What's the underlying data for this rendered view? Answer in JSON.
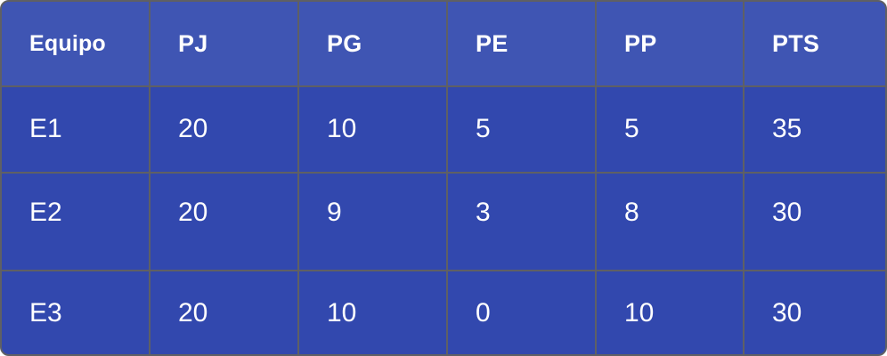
{
  "table": {
    "headers": [
      "Equipo",
      "PJ",
      "PG",
      "PE",
      "PP",
      "PTS"
    ],
    "rows": [
      [
        "E1",
        "20",
        "10",
        "5",
        "5",
        "35"
      ],
      [
        "E2",
        "20",
        "9",
        "3",
        "8",
        "30"
      ],
      [
        "E3",
        "20",
        "10",
        "0",
        "10",
        "30"
      ]
    ]
  },
  "colors": {
    "header_background": "#3f55b3",
    "body_background": "#3248ae",
    "grid_line": "#5f6064",
    "text": "#ffffff"
  }
}
